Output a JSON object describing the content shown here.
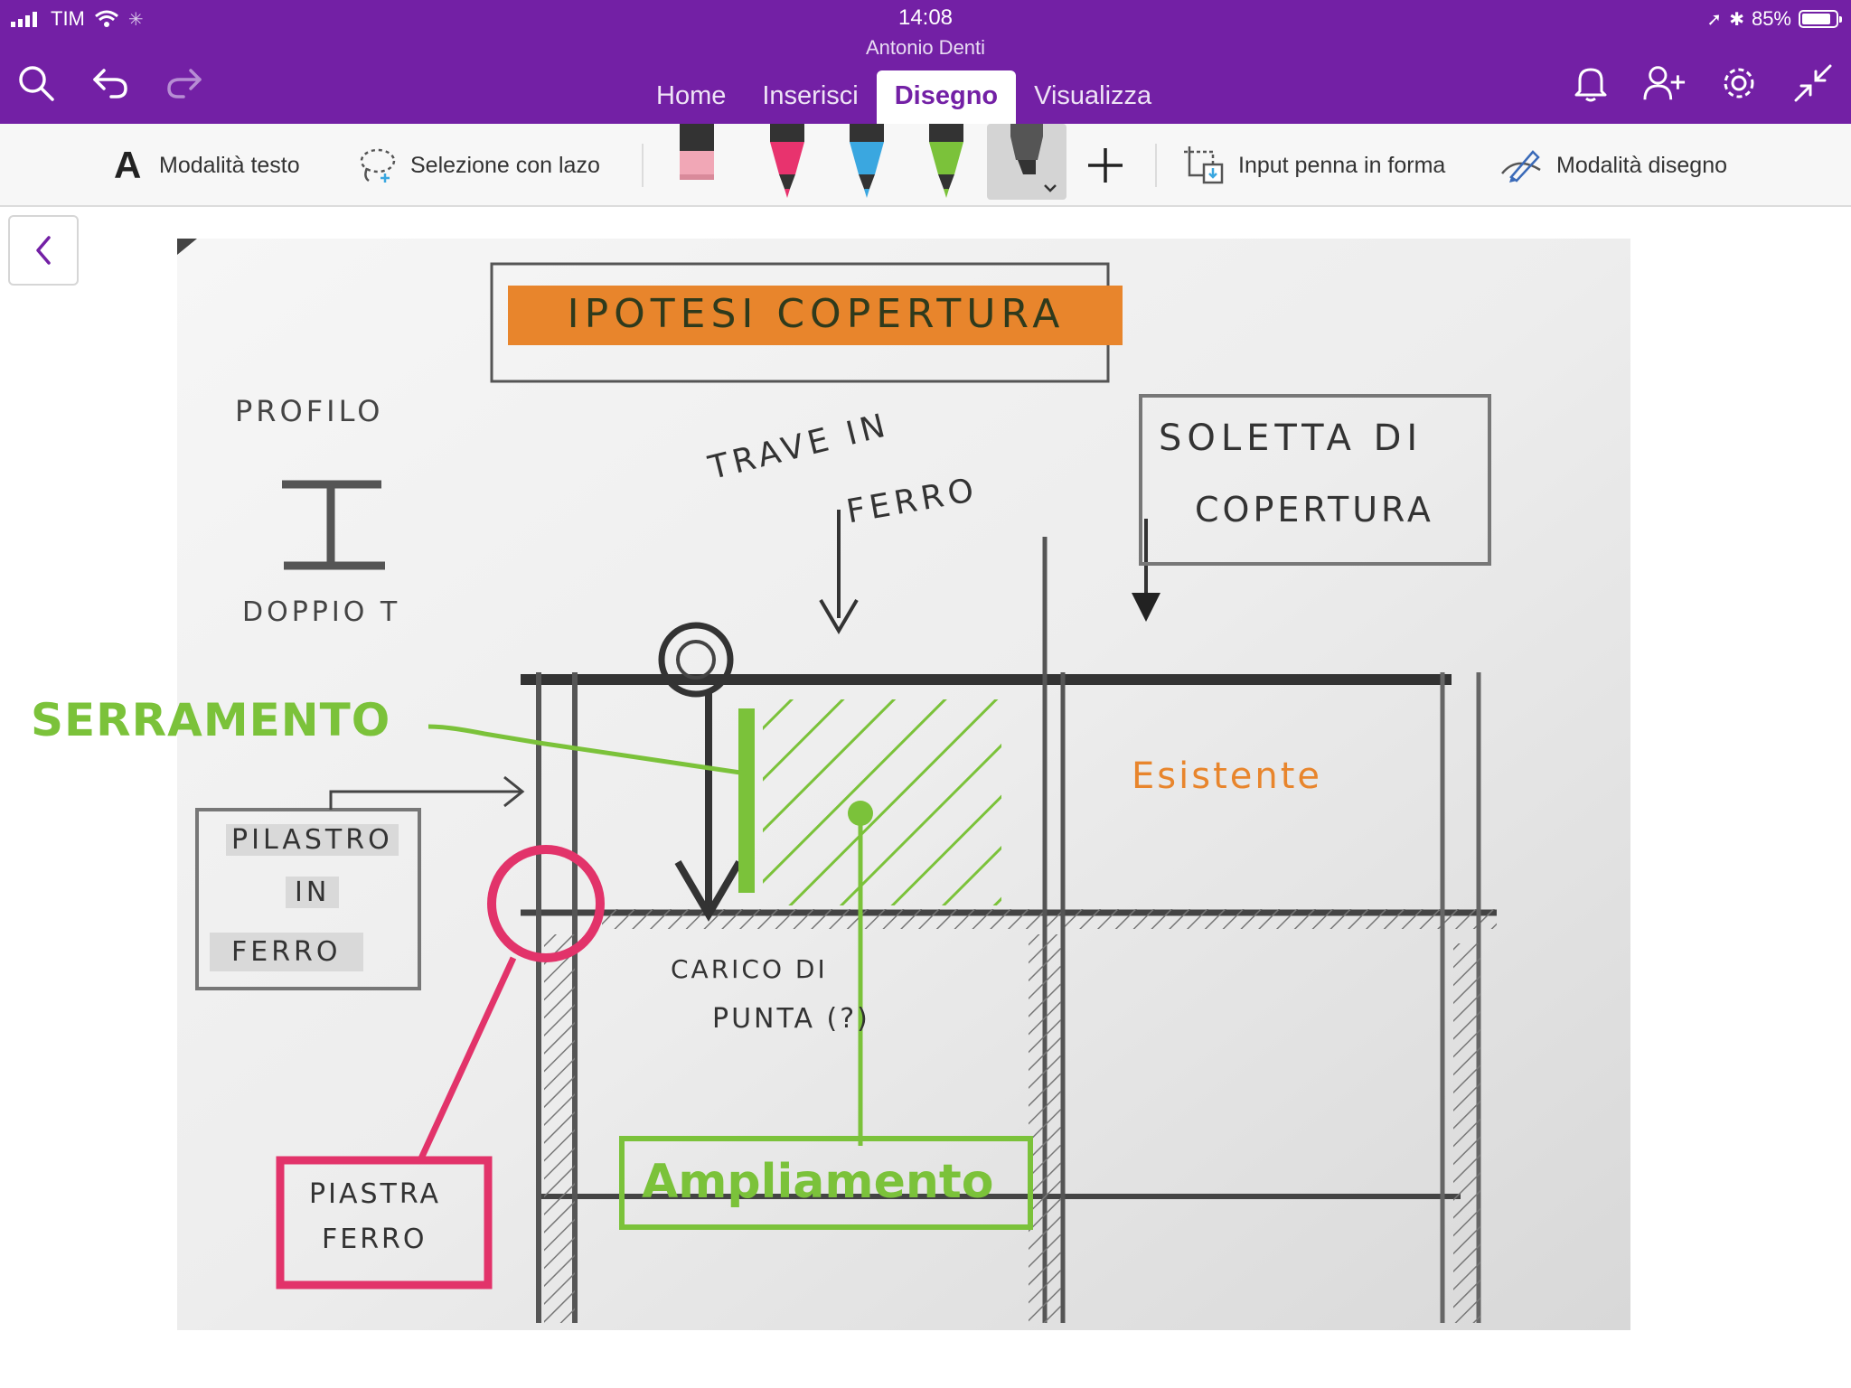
{
  "status": {
    "carrier": "TIM",
    "time": "14:08",
    "battery": "85%",
    "battery_level": 0.85
  },
  "header": {
    "subtitle": "Antonio Denti"
  },
  "tabs": [
    {
      "label": "Home"
    },
    {
      "label": "Inserisci"
    },
    {
      "label": "Disegno",
      "active": true
    },
    {
      "label": "Visualizza"
    }
  ],
  "toolbar": {
    "text_mode": "Modalità testo",
    "lasso": "Selezione con lazo",
    "ink_to_shape": "Input penna in forma",
    "draw_mode": "Modalità disegno",
    "pens": [
      {
        "icon": "eraser-icon",
        "color": "#f1a7b6"
      },
      {
        "icon": "pen-icon",
        "color": "#e8336e"
      },
      {
        "icon": "pen-icon",
        "color": "#3aa7e0"
      },
      {
        "icon": "pen-icon",
        "color": "#7bc23a"
      },
      {
        "icon": "highlighter-icon",
        "color": "#555555"
      }
    ]
  },
  "sketch": {
    "title": "IPOTESI COPERTURA",
    "profile_top": "PROFILO",
    "profile_bottom": "DOPPIO T",
    "beam": [
      "TRAVE IN",
      "FERRO"
    ],
    "slab": [
      "SOLETTA DI",
      "COPERTURA"
    ],
    "window": "SERRAMENTO",
    "existing": "Esistente",
    "pillar": [
      "PILASTRO",
      "IN",
      "FERRO"
    ],
    "load": [
      "CARICO DI",
      "PUNTA (?)"
    ],
    "plate": [
      "PIASTRA",
      "FERRO"
    ],
    "extension": "Ampliamento"
  },
  "colors": {
    "brand": "#7320a5",
    "green": "#7bc23a",
    "pink": "#e2336a",
    "orange": "#e8852c"
  }
}
